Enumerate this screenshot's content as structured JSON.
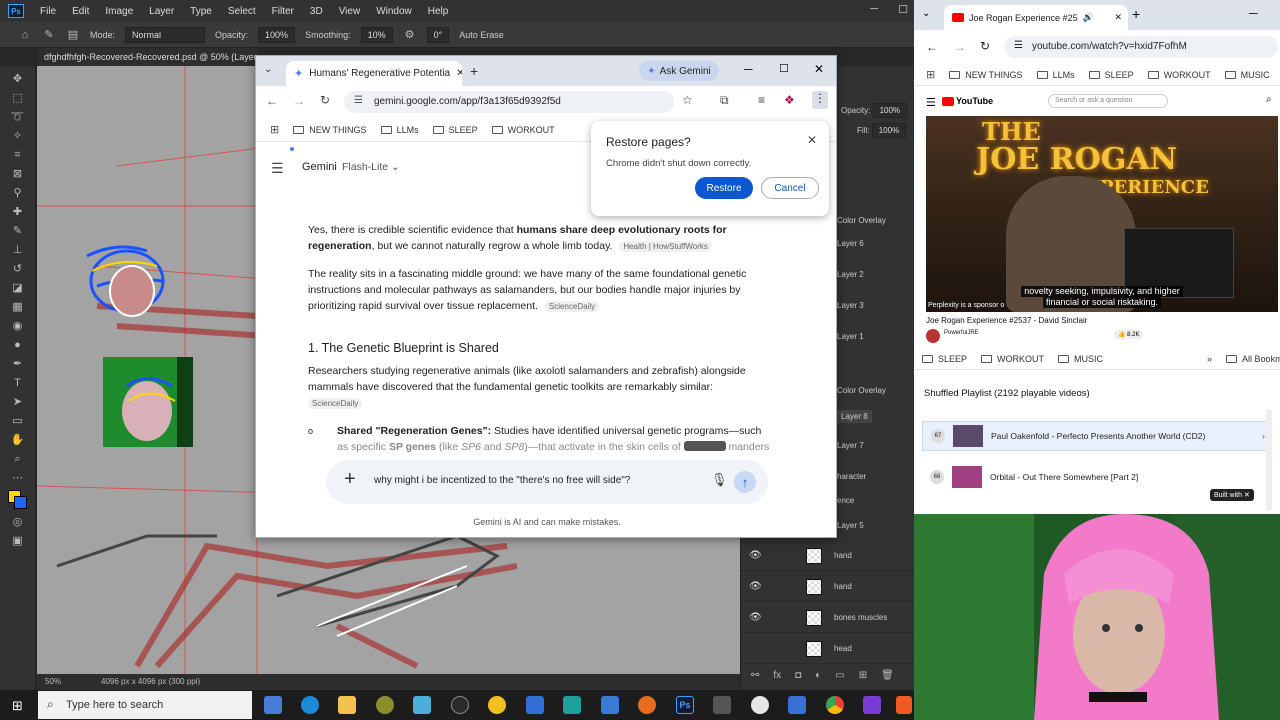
{
  "photoshop": {
    "logo": "Ps",
    "menus": [
      "File",
      "Edit",
      "Image",
      "Layer",
      "Type",
      "Select",
      "Filter",
      "3D",
      "View",
      "Window",
      "Help"
    ],
    "options": {
      "mode_label": "Mode:",
      "mode_value": "Normal",
      "opacity_label": "Opacity:",
      "opacity_value": "100%",
      "smoothing_label": "Smoothing:",
      "smoothing_value": "10%",
      "angle_value": "0°",
      "auto_erase": "Auto Erase"
    },
    "doc_tab": "dfghdfhfgh-Recovered-Recovered.psd @ 50% (Layer 8",
    "status": {
      "zoom": "50%",
      "size": "4096 px x 4096 px (300 ppi)"
    },
    "panel": {
      "opacity_label": "Opacity:",
      "opacity_value": "100%",
      "fill_label": "Fill:",
      "fill_value": "100%",
      "partial_labels": [
        "Color Overlay",
        "Layer 6",
        "Layer 2",
        "Layer 3",
        "Layer 1",
        "Color Overlay",
        "Layer 8",
        "Layer 7",
        "haracter",
        "ence",
        "Layer 5"
      ],
      "layers": [
        "hand",
        "hand",
        "bones muscles",
        "head"
      ]
    }
  },
  "gemini_window": {
    "tab_title": "Humans' Regenerative Potentia",
    "ask_gemini": "Ask Gemini",
    "url": "gemini.google.com/app/f3a13f65d9392f5d",
    "bookmarks": [
      "NEW THINGS",
      "LLMs",
      "SLEEP",
      "WORKOUT"
    ],
    "header": {
      "brand": "Gemini",
      "model": "Flash-Lite"
    },
    "restore_dialog": {
      "title": "Restore pages?",
      "message": "Chrome didn't shut down correctly.",
      "restore": "Restore",
      "cancel": "Cancel"
    },
    "response": {
      "p1_a": "Yes, there is credible scientific evidence that ",
      "p1_bold": "humans share deep evolutionary roots for regeneration",
      "p1_b": ", but we cannot naturally regrow a whole limb today.",
      "p1_src": "Health | HowStuffWorks",
      "p2": "The reality sits in a fascinating middle ground: we have many of the same foundational genetic instructions and molecular pathways as salamanders, but our bodies handle major injuries by prioritizing rapid survival over tissue replacement.",
      "p2_src": "ScienceDaily",
      "h3": "1. The Genetic Blueprint is Shared",
      "p3": "Researchers studying regenerative animals (like axolotl salamanders and zebrafish) alongside mammals have discovered that the fundamental genetic toolkits are remarkably similar:",
      "p3_src": "ScienceDaily",
      "bullet_bold": "Shared \"Regeneration Genes\":",
      "bullet_text": " Studies have identified universal genetic programs—such",
      "bullet_line2_a": "as specific ",
      "bullet_line2_bold": "SP genes",
      "bullet_line2_b": " (like ",
      "bullet_sp6": "SP6",
      "bullet_and": " and ",
      "bullet_sp8": "SP8",
      "bullet_line2_c": ")—that activate in the skin cells of",
      "bullet_line2_d": "manders"
    },
    "input_text": "why might i be incentized to the \"there's no free will side\"?",
    "disclaimer": "Gemini is AI and can make mistakes."
  },
  "youtube_window": {
    "tab_title": "Joe Rogan Experience #25",
    "url": "youtube.com/watch?v=hxid7FofhM",
    "bookmarks": [
      "NEW THINGS",
      "LLMs",
      "SLEEP",
      "WORKOUT",
      "MUSIC"
    ],
    "yt_logo": "YouTube",
    "search_placeholder": "Search or ask a question",
    "video_sign_line1": "THE",
    "video_sign_line2": "JOE ROGAN",
    "video_sign_line3": "XPERIENCE",
    "caption_line1": "novelty seeking, impulsivity, and higher",
    "caption_line2": "financial or social risktaking.",
    "sponsor_note": "Perplexity is a sponsor o",
    "video_title": "Joe Rogan Experience #2537 - David Sinclair",
    "channel": "PowerfulJRE",
    "likes": "8.2K"
  },
  "playlist_window": {
    "bookmarks": [
      "SLEEP",
      "WORKOUT",
      "MUSIC"
    ],
    "all_bookmarks": "All Bookmarks",
    "title": "Shuffled Playlist (2192 playable videos)",
    "items": [
      {
        "num": "67",
        "title": "Paul Oakenfold - Perfecto Presents Another World (CD2)"
      },
      {
        "num": "68",
        "title": "Orbital - Out There Somewhere [Part 2]"
      }
    ],
    "built_with": "Built with"
  },
  "taskbar": {
    "search_placeholder": "Type here to search",
    "ps_label": "Ps"
  },
  "colors": {
    "ps_bg": "#282828",
    "chrome_blue": "#0b57d0",
    "hair_pink": "#f27ac8",
    "green_screen": "#2a6b2a"
  }
}
